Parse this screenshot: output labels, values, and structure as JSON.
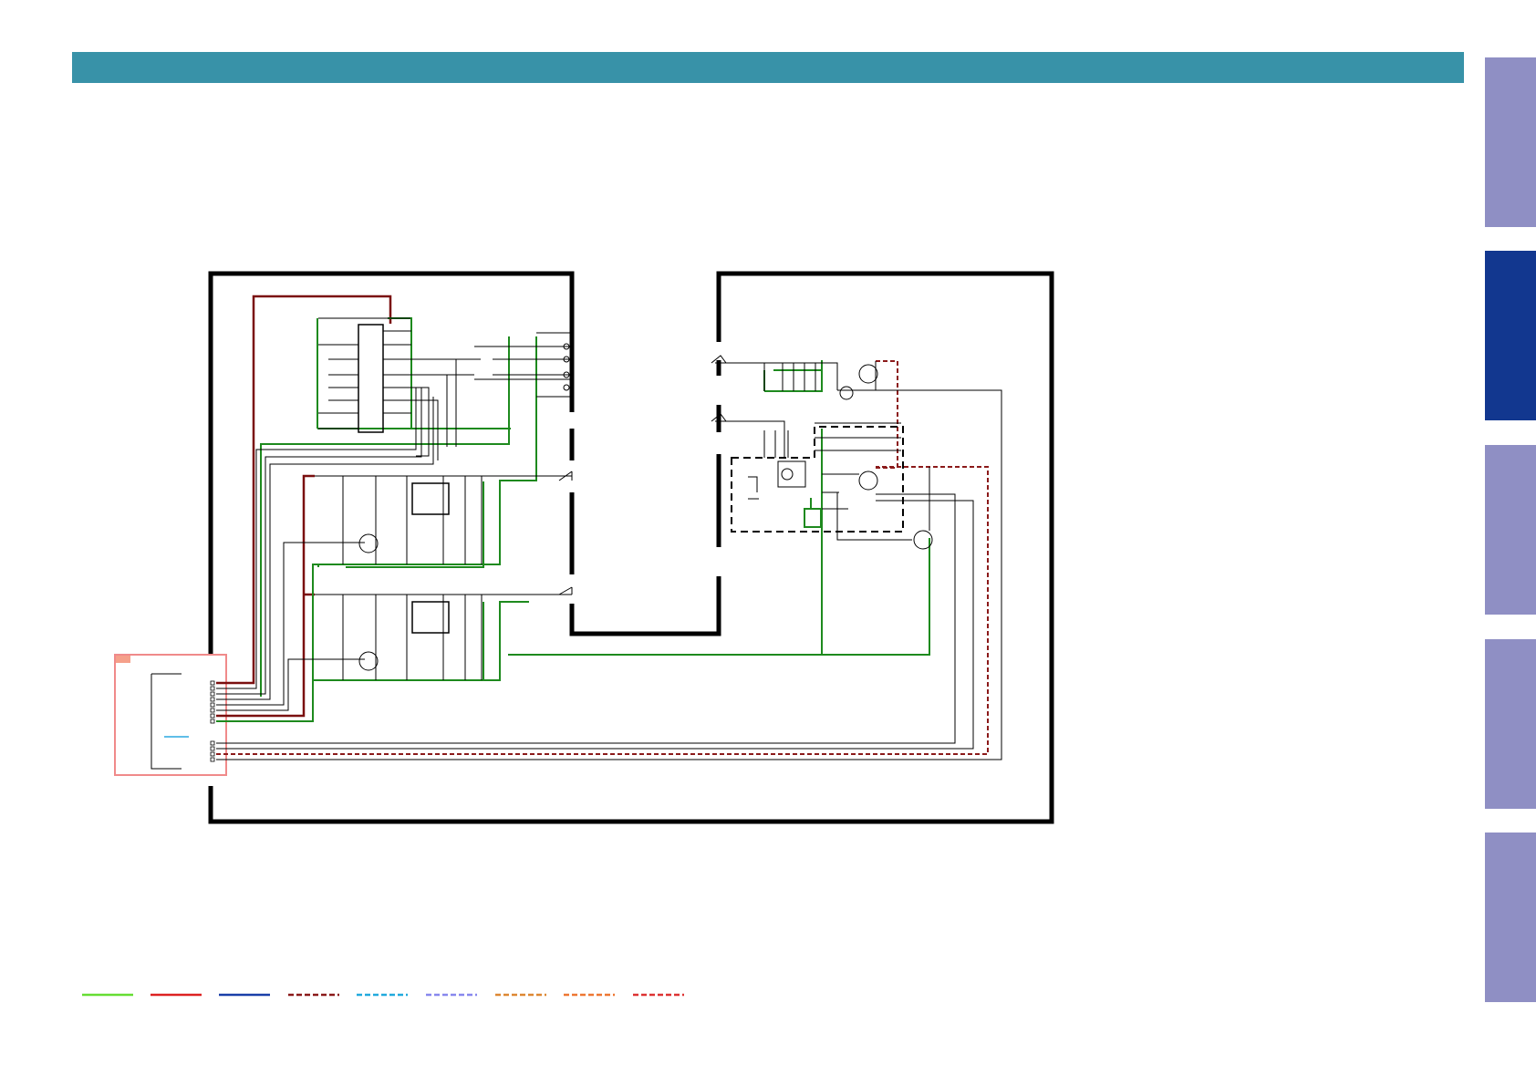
{
  "header": {
    "color": "#3892a8",
    "text": ""
  },
  "side_tabs": [
    {
      "id": "tab-1",
      "label": "",
      "active": false
    },
    {
      "id": "tab-2",
      "label": "",
      "active": true
    },
    {
      "id": "tab-3",
      "label": "",
      "active": false
    },
    {
      "id": "tab-4",
      "label": "",
      "active": false
    },
    {
      "id": "tab-5",
      "label": "",
      "active": false
    }
  ],
  "colors": {
    "tab_inactive": "#8f8fc4",
    "tab_active": "#12378f",
    "wire": "#000000",
    "ground": "#1e8a1e",
    "power": "#7a0f0f",
    "connector_box": "#f08a8a",
    "connector_tag": "#f5a08a",
    "blue_mark": "#2aa8e0"
  },
  "legend": [
    {
      "color": "#66dd33",
      "style": "solid"
    },
    {
      "color": "#dd2222",
      "style": "solid"
    },
    {
      "color": "#1a3fa8",
      "style": "solid"
    },
    {
      "color": "#8b1a1a",
      "style": "dashed"
    },
    {
      "color": "#22aadd",
      "style": "dashed"
    },
    {
      "color": "#8888ee",
      "style": "dashed"
    },
    {
      "color": "#dd8833",
      "style": "dashed"
    },
    {
      "color": "#ee7733",
      "style": "dashed"
    },
    {
      "color": "#dd3333",
      "style": "dashed"
    }
  ]
}
